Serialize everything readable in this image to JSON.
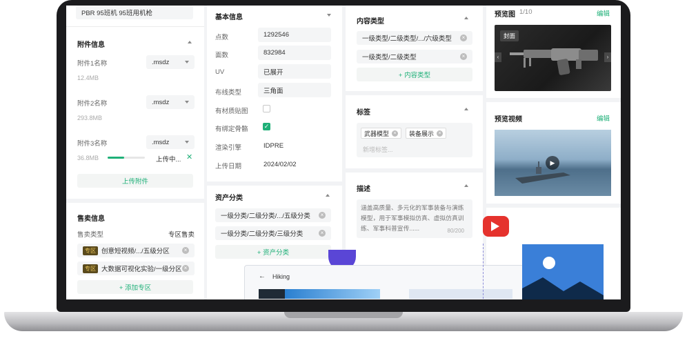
{
  "top_item": "PBR 95班机 95班用机枪",
  "attachments": {
    "title": "附件信息",
    "items": [
      {
        "name": "附件1名称",
        "ext": ".msdz",
        "size": "12.4MB"
      },
      {
        "name": "附件2名称",
        "ext": ".msdz",
        "size": "293.8MB"
      },
      {
        "name": "附件3名称",
        "ext": ".msdz",
        "size": "36.8MB",
        "status": "上传中...",
        "progress": 0.45
      }
    ],
    "upload_label": "上传附件"
  },
  "sales": {
    "title": "售卖信息",
    "type_label": "售卖类型",
    "type_value": "专区售卖",
    "zones": [
      {
        "tag": "专区",
        "text": "创意短视频/.../五级分区"
      },
      {
        "tag": "专区",
        "text": "大数据可视化实验/一级分区"
      }
    ],
    "add_label": "+ 添加专区"
  },
  "basic": {
    "title": "基本信息",
    "rows": [
      {
        "label": "点数",
        "value": "1292546"
      },
      {
        "label": "面数",
        "value": "832984"
      },
      {
        "label": "UV",
        "value": "已展开"
      },
      {
        "label": "布线类型",
        "value": "三角面"
      }
    ],
    "checks": [
      {
        "label": "有材质贴图",
        "checked": false
      },
      {
        "label": "有绑定骨骼",
        "checked": true
      }
    ],
    "engine_label": "渲染引擎",
    "engine_value": "IDPRE",
    "date_label": "上传日期",
    "date_value": "2024/02/02"
  },
  "asset": {
    "title": "资产分类",
    "items": [
      "一级分类/二级分类/.../五级分类",
      "一级分类/二级分类/三级分类"
    ],
    "add_label": "+ 资产分类"
  },
  "content": {
    "title": "内容类型",
    "items": [
      "一级类型/二级类型/.../六级类型",
      "一级类型/二级类型"
    ],
    "add_label": "+ 内容类型"
  },
  "tags": {
    "title": "标签",
    "items": [
      "武器模型",
      "装备展示"
    ],
    "placeholder": "新增标签..."
  },
  "desc": {
    "title": "描述",
    "text": "涵盖高质量、多元化的军事装备与演练模型，用于军事模拟仿真、虚拟仿真训练、军事科普宣传......",
    "count": "80/200"
  },
  "preview": {
    "title": "预览图",
    "count": "1/10",
    "edit": "编辑",
    "cover": "封面"
  },
  "video": {
    "title": "预览视频",
    "edit": "编辑"
  },
  "overlay": {
    "title": "Hiking"
  },
  "colors": {
    "accent": "#1fb078",
    "tag_bg": "#5a4a1c",
    "tag_fg": "#e8c45a",
    "youtube": "#e5322d"
  }
}
